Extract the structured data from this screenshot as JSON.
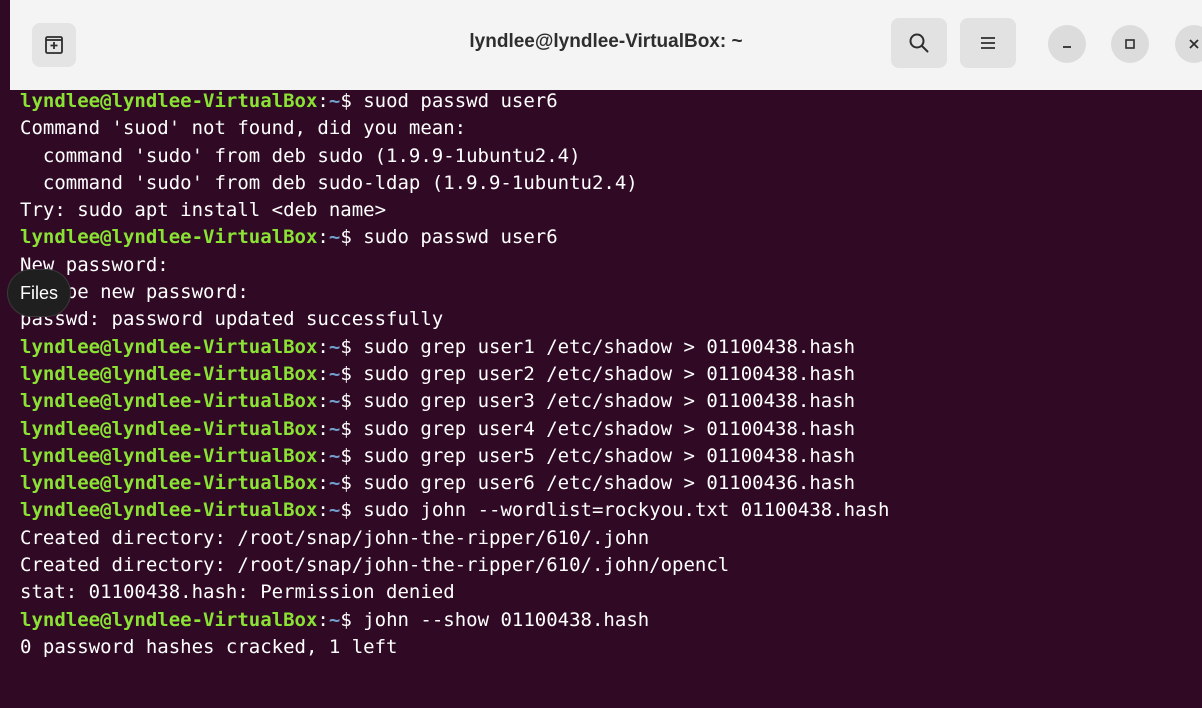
{
  "window": {
    "title": "lyndlee@lyndlee-VirtualBox: ~"
  },
  "icons": {
    "new_tab": "new-tab-icon",
    "search": "search-icon",
    "menu": "hamburger-menu-icon",
    "minimize": "minimize-icon",
    "maximize": "maximize-icon",
    "close": "close-icon"
  },
  "colors": {
    "background": "#300a24",
    "prompt_user": "#8ae234",
    "prompt_path": "#729fcf",
    "text": "#ffffff"
  },
  "prompt": {
    "user_host": "lyndlee@lyndlee-VirtualBox",
    "separator": ":",
    "path": "~",
    "symbol": "$ "
  },
  "tooltip": {
    "label": "Files"
  },
  "lines": [
    {
      "type": "cmd",
      "text": "suod passwd user6"
    },
    {
      "type": "out",
      "text": "Command 'suod' not found, did you mean:"
    },
    {
      "type": "out",
      "text": "  command 'sudo' from deb sudo (1.9.9-1ubuntu2.4)"
    },
    {
      "type": "out",
      "text": "  command 'sudo' from deb sudo-ldap (1.9.9-1ubuntu2.4)"
    },
    {
      "type": "out",
      "text": "Try: sudo apt install <deb name>"
    },
    {
      "type": "cmd",
      "text": "sudo passwd user6"
    },
    {
      "type": "out",
      "text": "New password:"
    },
    {
      "type": "out",
      "text": "Retype new password:"
    },
    {
      "type": "out",
      "text": "passwd: password updated successfully"
    },
    {
      "type": "cmd",
      "text": "sudo grep user1 /etc/shadow > 01100438.hash"
    },
    {
      "type": "cmd",
      "text": "sudo grep user2 /etc/shadow > 01100438.hash"
    },
    {
      "type": "cmd",
      "text": "sudo grep user3 /etc/shadow > 01100438.hash"
    },
    {
      "type": "cmd",
      "text": "sudo grep user4 /etc/shadow > 01100438.hash"
    },
    {
      "type": "cmd",
      "text": "sudo grep user5 /etc/shadow > 01100438.hash"
    },
    {
      "type": "cmd",
      "text": "sudo grep user6 /etc/shadow > 01100436.hash"
    },
    {
      "type": "cmd",
      "text": "sudo john --wordlist=rockyou.txt 01100438.hash"
    },
    {
      "type": "out",
      "text": "Created directory: /root/snap/john-the-ripper/610/.john"
    },
    {
      "type": "out",
      "text": "Created directory: /root/snap/john-the-ripper/610/.john/opencl"
    },
    {
      "type": "out",
      "text": "stat: 01100438.hash: Permission denied"
    },
    {
      "type": "cmd",
      "text": "john --show 01100438.hash"
    },
    {
      "type": "out",
      "text": "0 password hashes cracked, 1 left"
    }
  ]
}
